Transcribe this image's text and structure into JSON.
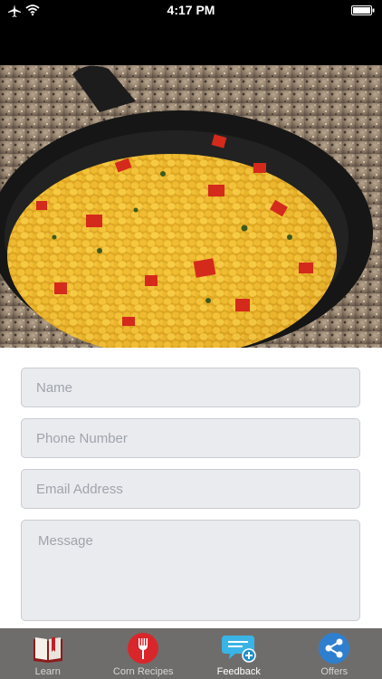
{
  "status_bar": {
    "time": "4:17 PM"
  },
  "form": {
    "name_placeholder": "Name",
    "phone_placeholder": "Phone Number",
    "email_placeholder": "Email Address",
    "message_placeholder": "Message"
  },
  "tabs": [
    {
      "label": "Learn",
      "icon": "book-icon",
      "active": false
    },
    {
      "label": "Corn Recipes",
      "icon": "fork-icon",
      "active": false
    },
    {
      "label": "Feedback",
      "icon": "chat-plus-icon",
      "active": true
    },
    {
      "label": "Offers",
      "icon": "share-icon",
      "active": false
    }
  ],
  "colors": {
    "status_bar": "#000000",
    "tab_bar": "#6f6d6b",
    "field_bg": "#e9ebef",
    "fork_red": "#d9262b",
    "offers_blue": "#2f7fd0",
    "feedback_cyan": "#3ab4e6"
  }
}
